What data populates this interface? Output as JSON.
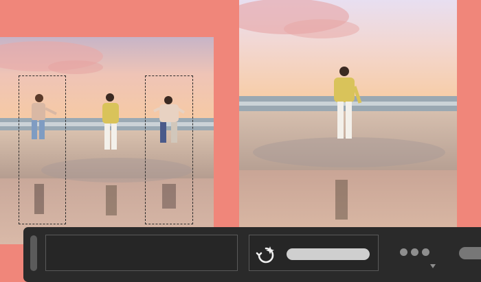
{
  "window": {
    "title": ""
  },
  "colors": {
    "background": "#f0867a",
    "toolbar": "#2a2a2a",
    "panel_border": "#5a5a5a",
    "slider": "#cfcfcf",
    "selection": "#2a2a2a"
  },
  "images": {
    "before": {
      "description_icon": "beach-photo-with-people"
    },
    "after": {
      "description_icon": "beach-photo-single-person"
    }
  },
  "toolbar": {
    "magic_icon": "magic-sparkle-icon",
    "more_icon": "more-dots-icon",
    "dropdown_icon": "chevron-down-icon"
  }
}
